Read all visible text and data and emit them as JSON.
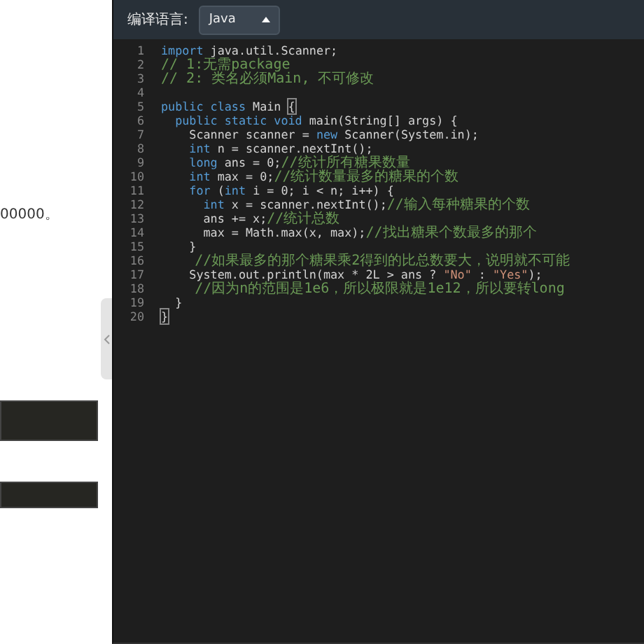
{
  "left_panel": {
    "text": "00000。"
  },
  "editor": {
    "language_label": "编译语言:",
    "language_select": {
      "value": "Java"
    },
    "lines": [
      {
        "number": "1",
        "tokens": [
          {
            "kind": "keyword",
            "text": "import"
          },
          {
            "kind": "plain",
            "text": " java.util.Scanner;"
          }
        ]
      },
      {
        "number": "2",
        "tokens": [
          {
            "kind": "comment",
            "text": "// 1:无需package"
          }
        ]
      },
      {
        "number": "3",
        "tokens": [
          {
            "kind": "comment",
            "text": "// 2: 类名必须Main, 不可修改"
          }
        ]
      },
      {
        "number": "4"
      },
      {
        "number": "5",
        "tokens": [
          {
            "kind": "keyword",
            "text": "public class"
          },
          {
            "kind": "plain",
            "text": " Main "
          },
          {
            "kind": "bracket",
            "text": "{"
          }
        ]
      },
      {
        "number": "6",
        "tokens": [
          {
            "kind": "keyword",
            "text": "  public static void"
          },
          {
            "kind": "plain",
            "text": " main(String[] args) {"
          }
        ]
      },
      {
        "number": "7",
        "tokens": [
          {
            "kind": "plain",
            "text": "    Scanner scanner = "
          },
          {
            "kind": "keyword",
            "text": "new"
          },
          {
            "kind": "plain",
            "text": " Scanner(System.in);"
          }
        ]
      },
      {
        "number": "8",
        "tokens": [
          {
            "kind": "keyword",
            "text": "    int"
          },
          {
            "kind": "plain",
            "text": " n = scanner.nextInt();"
          }
        ]
      },
      {
        "number": "9",
        "tokens": [
          {
            "kind": "keyword",
            "text": "    long"
          },
          {
            "kind": "plain",
            "text": " ans = 0;"
          },
          {
            "kind": "comment",
            "text": "//统计所有糖果数量"
          }
        ]
      },
      {
        "number": "10",
        "tokens": [
          {
            "kind": "keyword",
            "text": "    int"
          },
          {
            "kind": "plain",
            "text": " max = 0;"
          },
          {
            "kind": "comment",
            "text": "//统计数量最多的糖果的个数"
          }
        ]
      },
      {
        "number": "11",
        "tokens": [
          {
            "kind": "keyword",
            "text": "    for"
          },
          {
            "kind": "plain",
            "text": " ("
          },
          {
            "kind": "keyword",
            "text": "int"
          },
          {
            "kind": "plain",
            "text": " i = 0; i < n; i++) {"
          }
        ]
      },
      {
        "number": "12",
        "tokens": [
          {
            "kind": "keyword",
            "text": "      int"
          },
          {
            "kind": "plain",
            "text": " x = scanner.nextInt();"
          },
          {
            "kind": "comment",
            "text": "//输入每种糖果的个数"
          }
        ]
      },
      {
        "number": "13",
        "tokens": [
          {
            "kind": "plain",
            "text": "      ans += x;"
          },
          {
            "kind": "comment",
            "text": "//统计总数"
          }
        ]
      },
      {
        "number": "14",
        "tokens": [
          {
            "kind": "plain",
            "text": "      max = Math.max(x, max);"
          },
          {
            "kind": "comment",
            "text": "//找出糖果个数最多的那个"
          }
        ]
      },
      {
        "number": "15",
        "tokens": [
          {
            "kind": "plain",
            "text": "    }"
          }
        ]
      },
      {
        "number": "16",
        "tokens": [
          {
            "kind": "comment",
            "text": "    //如果最多的那个糖果乘2得到的比总数要大，说明就不可能"
          }
        ]
      },
      {
        "number": "17",
        "tokens": [
          {
            "kind": "plain",
            "text": "    System.out.println(max * 2L > ans ? "
          },
          {
            "kind": "string",
            "text": "\"No\""
          },
          {
            "kind": "plain",
            "text": " : "
          },
          {
            "kind": "string",
            "text": "\"Yes\""
          },
          {
            "kind": "plain",
            "text": ");"
          }
        ]
      },
      {
        "number": "18",
        "tokens": [
          {
            "kind": "comment",
            "text": "    //因为n的范围是1e6，所以极限就是1e12，所以要转long"
          }
        ]
      },
      {
        "number": "19",
        "tokens": [
          {
            "kind": "plain",
            "text": "  }"
          }
        ]
      },
      {
        "number": "20",
        "tokens": [
          {
            "kind": "bracket",
            "text": "}"
          }
        ]
      }
    ]
  }
}
